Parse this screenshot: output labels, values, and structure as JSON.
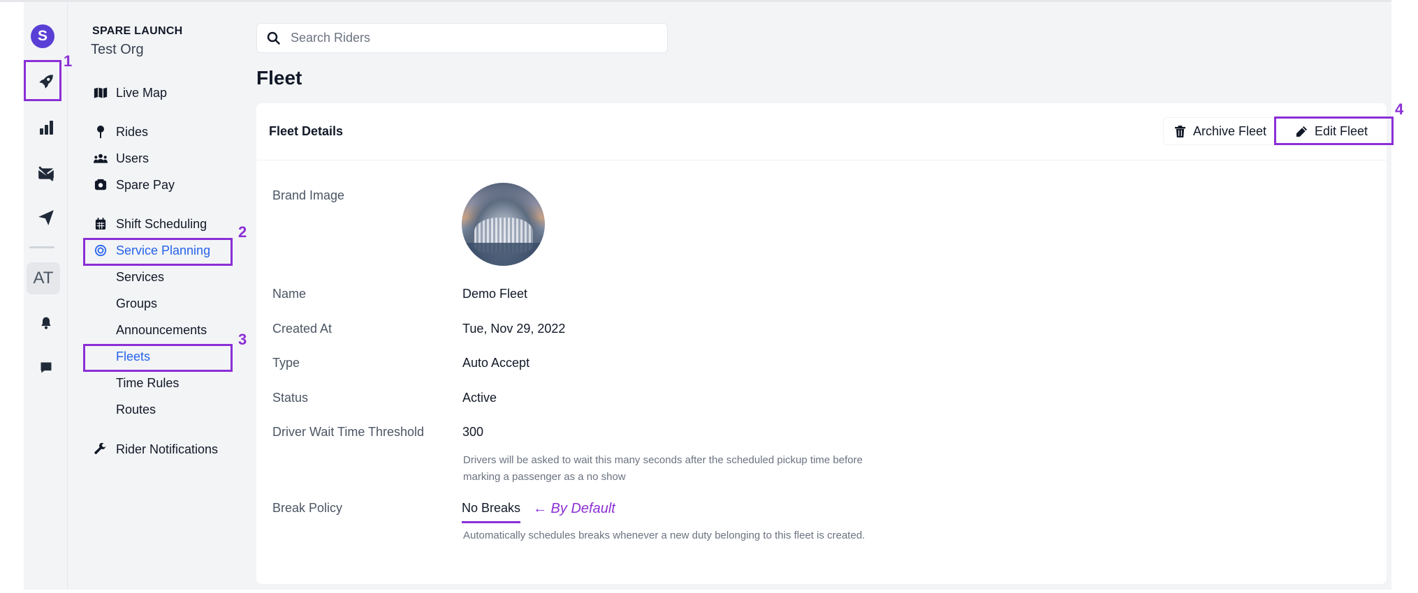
{
  "rail": {
    "logo_letter": "S",
    "avatar_initials": "AT",
    "accent": "#5a3fd6"
  },
  "sidebar": {
    "org_label": "SPARE LAUNCH",
    "org_name": "Test Org",
    "items": [
      {
        "label": "Live Map",
        "icon": "map-icon"
      },
      {
        "label": "Rides",
        "icon": "pin-icon"
      },
      {
        "label": "Users",
        "icon": "users-icon"
      },
      {
        "label": "Spare Pay",
        "icon": "wallet-icon"
      },
      {
        "label": "Shift Scheduling",
        "icon": "calendar-icon"
      },
      {
        "label": "Service Planning",
        "icon": "target-icon",
        "active": true
      },
      {
        "label": "Rider Notifications",
        "icon": "wrench-icon"
      }
    ],
    "sub_items": [
      "Services",
      "Groups",
      "Announcements",
      "Fleets",
      "Time Rules",
      "Routes"
    ],
    "active_sub": "Fleets"
  },
  "annotations": {
    "numbers": [
      "1",
      "2",
      "3",
      "4"
    ],
    "by_default": "← By Default",
    "color": "#8b2fd6"
  },
  "search": {
    "placeholder": "Search Riders"
  },
  "page": {
    "title": "Fleet"
  },
  "card": {
    "title": "Fleet Details",
    "archive_label": "Archive Fleet",
    "edit_label": "Edit Fleet",
    "fields": {
      "brand_image_label": "Brand Image",
      "name_label": "Name",
      "name_value": "Demo Fleet",
      "created_label": "Created At",
      "created_value": "Tue, Nov 29, 2022",
      "type_label": "Type",
      "type_value": "Auto Accept",
      "status_label": "Status",
      "status_value": "Active",
      "wait_label": "Driver Wait Time Threshold",
      "wait_value": "300",
      "wait_help": "Drivers will be asked to wait this many seconds after the scheduled pickup time before marking a passenger as a no show",
      "break_label": "Break Policy",
      "break_value": "No Breaks",
      "break_help": "Automatically schedules breaks whenever a new duty belonging to this fleet is created."
    }
  }
}
